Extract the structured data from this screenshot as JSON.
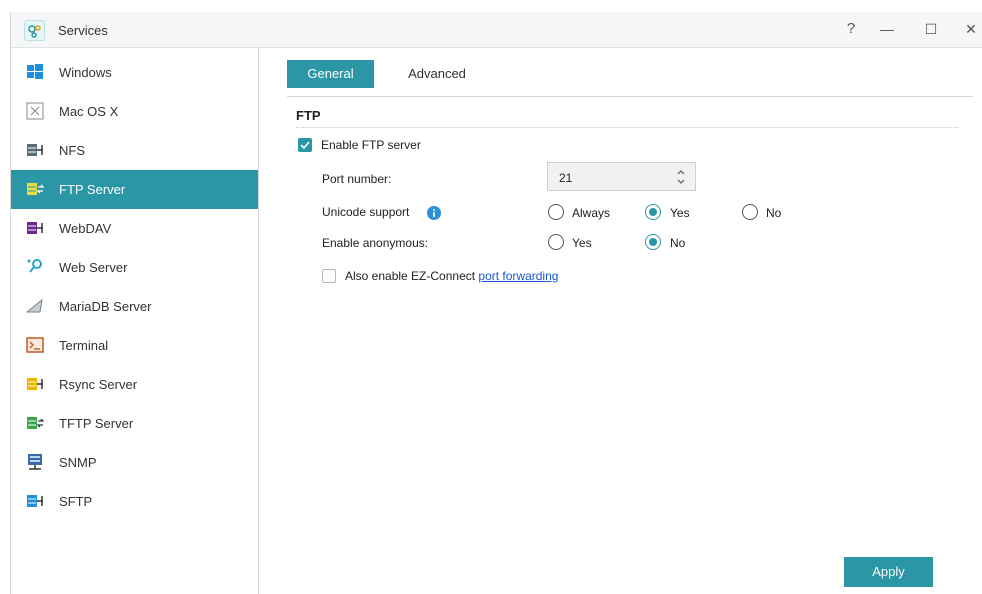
{
  "window": {
    "title": "Services",
    "controls": {
      "help": "?",
      "minimize": "—",
      "maximize": "☐",
      "close": "✕"
    }
  },
  "sidebar": {
    "items": [
      {
        "label": "Windows",
        "icon": "windows-icon"
      },
      {
        "label": "Mac OS X",
        "icon": "macos-icon"
      },
      {
        "label": "NFS",
        "icon": "nfs-icon"
      },
      {
        "label": "FTP Server",
        "icon": "ftp-server-icon",
        "active": true
      },
      {
        "label": "WebDAV",
        "icon": "webdav-icon"
      },
      {
        "label": "Web Server",
        "icon": "web-server-icon"
      },
      {
        "label": "MariaDB Server",
        "icon": "mariadb-icon"
      },
      {
        "label": "Terminal",
        "icon": "terminal-icon"
      },
      {
        "label": "Rsync Server",
        "icon": "rsync-icon"
      },
      {
        "label": "TFTP Server",
        "icon": "tftp-icon"
      },
      {
        "label": "SNMP",
        "icon": "snmp-icon"
      },
      {
        "label": "SFTP",
        "icon": "sftp-icon"
      }
    ]
  },
  "tabs": {
    "general": "General",
    "advanced": "Advanced",
    "active": "General"
  },
  "ftp": {
    "section_title": "FTP",
    "enable_label": "Enable FTP server",
    "enable_checked": true,
    "port_label": "Port number:",
    "port_value": "21",
    "unicode_label": "Unicode support",
    "unicode_options": [
      "Always",
      "Yes",
      "No"
    ],
    "unicode_selected": "Yes",
    "anonymous_label": "Enable anonymous:",
    "anonymous_options": [
      "Yes",
      "No"
    ],
    "anonymous_selected": "No",
    "ezconnect_label": "Also enable EZ-Connect ",
    "ezconnect_link": "port forwarding",
    "ezconnect_checked": false
  },
  "actions": {
    "apply": "Apply"
  },
  "colors": {
    "accent": "#2b96a6",
    "link": "#1a56d6"
  }
}
